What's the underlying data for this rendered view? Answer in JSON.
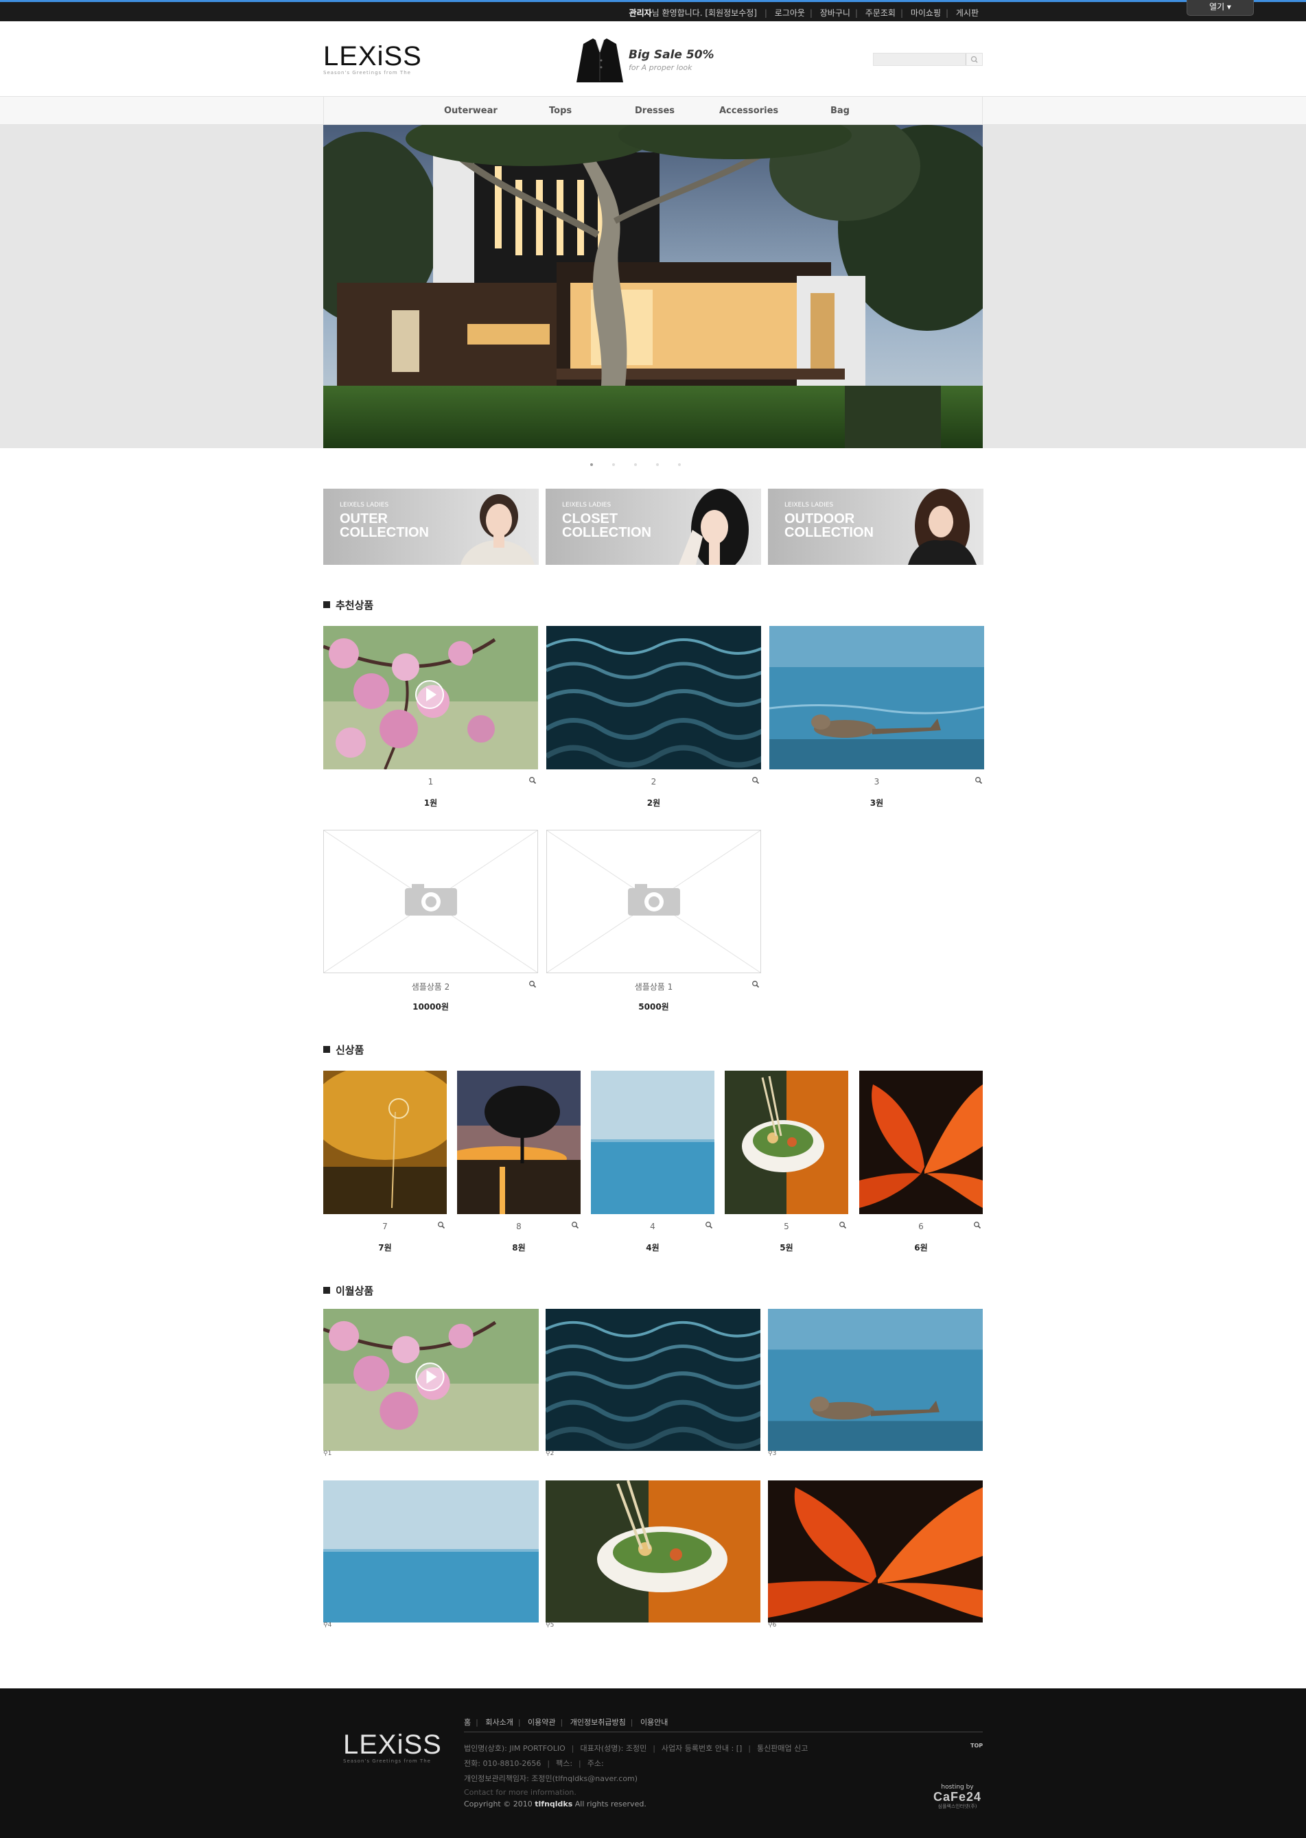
{
  "topbar": {
    "admin": "관리자",
    "welcome": "님 환영합니다.",
    "member_edit": "[회원정보수정]",
    "links": [
      "로그아웃",
      "장바구니",
      "주문조회",
      "마이쇼핑",
      "게시판"
    ],
    "open_label": "열기 ▾"
  },
  "header": {
    "logo": "LEXiSS",
    "logo_sub": "Season's Greetings from The",
    "sale_title": "Big Sale 50%",
    "sale_sub": "for A proper look",
    "search_placeholder": ""
  },
  "nav": {
    "items": [
      "Outerwear",
      "Tops",
      "Dresses",
      "Accessories",
      "Bag"
    ]
  },
  "hero": {
    "slides": 5,
    "active_slide": 1
  },
  "banners": [
    {
      "small": "LEIXELS LADIES",
      "line1": "OUTER",
      "line2": "COLLECTION"
    },
    {
      "small": "LEIXELS LADIES",
      "line1": "CLOSET",
      "line2": "COLLECTION"
    },
    {
      "small": "LEIXELS LADIES",
      "line1": "OUTDOOR",
      "line2": "COLLECTION"
    }
  ],
  "recommended": {
    "title": "추천상품",
    "items": [
      {
        "name": "1",
        "price": "1원",
        "image": "cherry-blossom"
      },
      {
        "name": "2",
        "price": "2원",
        "image": "dark-water"
      },
      {
        "name": "3",
        "price": "3원",
        "image": "seal"
      },
      {
        "name": "샘플상품 2",
        "price": "10000원",
        "image": "no-image"
      },
      {
        "name": "샘플상품 1",
        "price": "5000원",
        "image": "no-image"
      }
    ]
  },
  "new_products": {
    "title": "신상품",
    "items": [
      {
        "name": "7",
        "price": "7원",
        "image": "dandelion"
      },
      {
        "name": "8",
        "price": "8원",
        "image": "sunset-tree"
      },
      {
        "name": "4",
        "price": "4원",
        "image": "sea"
      },
      {
        "name": "5",
        "price": "5원",
        "image": "salad-bowl"
      },
      {
        "name": "6",
        "price": "6원",
        "image": "lily"
      }
    ]
  },
  "monthly": {
    "title": "이월상품",
    "items": [
      {
        "name": "1",
        "image": "cherry-blossom"
      },
      {
        "name": "2",
        "image": "dark-water"
      },
      {
        "name": "3",
        "image": "seal"
      },
      {
        "name": "4",
        "image": "sea"
      },
      {
        "name": "5",
        "image": "salad-bowl"
      },
      {
        "name": "6",
        "image": "lily"
      }
    ]
  },
  "footer": {
    "logo": "LEXiSS",
    "logo_sub": "Season's Greetings from The",
    "links": [
      "홈",
      "회사소개",
      "이용약관",
      "개인정보취급방침",
      "이용안내"
    ],
    "company": "법인명(상호): JIM PORTFOLIO",
    "ceo": "대표자(성명): 조정민",
    "bizno": "사업자 등록번호 안내 : []",
    "mailorder": "통신판매업 신고",
    "phone": "전화: 010-8810-2656",
    "fax": "팩스:",
    "address": "주소:",
    "privacy_officer": "개인정보관리책임자: 조정민(tlfnqldks@naver.com)",
    "contact": "Contact for more information.",
    "copyright_pre": "Copyright © 2010",
    "copyright_site": "tlfnqldks",
    "copyright_post": "All rights reserved.",
    "top": "TOP",
    "hosting": "hosting by",
    "cafe": "CaFe24",
    "cafe_sub": "심플렉스인터넷(주)"
  },
  "colors": {
    "topbar_bg": "#1b1b1b",
    "topbar_accent": "#3f8fe0",
    "footer_bg": "#111111",
    "hero_bg": "#e6e6e6"
  }
}
